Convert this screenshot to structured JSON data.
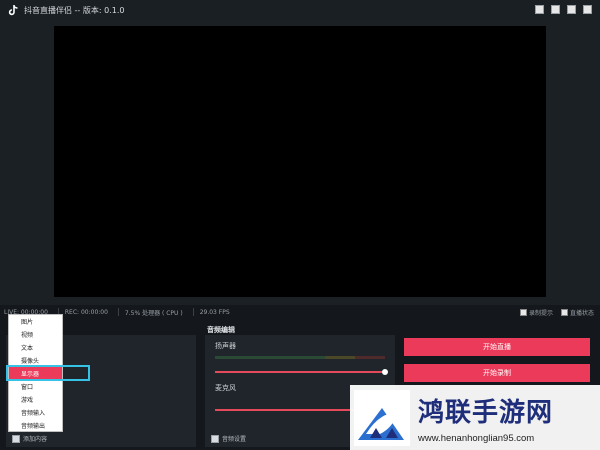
{
  "window": {
    "title": "抖音直播伴侣 -- 版本: 0.1.0",
    "icon": "tiktok-icon",
    "buttons": [
      "minimize-icon",
      "settings-icon",
      "maximize-icon",
      "close-icon"
    ]
  },
  "status": {
    "live": "LIVE: 00:00:00",
    "rec": "REC: 00:00:00",
    "cpu": "7.5% 处理器 ( CPU )",
    "fps": "29.03 FPS",
    "toggle1": "录制提示",
    "toggle2": "直播状态"
  },
  "sources": {
    "add_label": "添加内容"
  },
  "audio": {
    "header": "音频编辑",
    "speaker_label": "扬声器",
    "mic_label": "麦克风",
    "settings_label": "音频设置"
  },
  "actions": {
    "start_live": "开始直播",
    "start_record": "开始录制"
  },
  "menu": {
    "items": [
      "图片",
      "视频",
      "文本",
      "摄像头",
      "显示器",
      "窗口",
      "游戏",
      "音频输入",
      "音频输出"
    ],
    "active_index": 4
  },
  "watermark": {
    "name": "鸿联手游网",
    "url": "www.henanhonglian95.com"
  },
  "colors": {
    "accent": "#ec3b5a",
    "highlight": "#36c2e6",
    "background": "#14181d"
  }
}
